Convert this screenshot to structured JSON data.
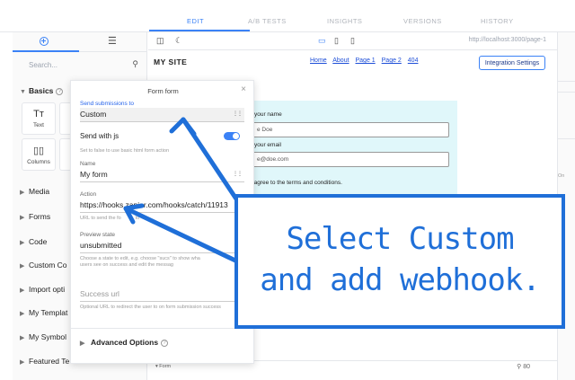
{
  "top_tabs": [
    {
      "label": "EDIT",
      "active": true
    },
    {
      "label": "A/B TESTS",
      "active": false
    },
    {
      "label": "INSIGHTS",
      "active": false
    },
    {
      "label": "VERSIONS",
      "active": false
    },
    {
      "label": "HISTORY",
      "active": false
    }
  ],
  "sidebar": {
    "search_placeholder": "Search...",
    "basics_label": "Basics",
    "blocks": {
      "text": "Text",
      "columns": "Columns"
    },
    "items": [
      "Media",
      "Forms",
      "Code",
      "Custom Co",
      "Import opti",
      "My Templat",
      "My Symbol",
      "Featured Te"
    ]
  },
  "canvas": {
    "url": "http://localhost:3000/page-1",
    "site_title": "MY SITE",
    "nav": [
      "Home",
      "About",
      "Page 1",
      "Page 2",
      "404"
    ],
    "integration_button": "Integration Settings",
    "form_labels": [
      "r your name",
      "r your email",
      "I agree to the terms and conditions."
    ],
    "form_values": [
      "e Doe",
      "e@doe.com"
    ],
    "bottom_label": "Form",
    "zoom": "80",
    "rail_text": "On"
  },
  "panel": {
    "title": "Form form",
    "send_submissions_label": "Send submissions to",
    "send_submissions_value": "Custom",
    "send_with_js_label": "Send with js",
    "send_with_js_on": true,
    "send_with_js_help": "Set to false to use basic html form action",
    "name_label": "Name",
    "name_value": "My form",
    "action_label": "Action",
    "action_value": "https://hooks.zapier.com/hooks/catch/11913",
    "action_help": "URL to send the fo",
    "action_help_tail": "to",
    "preview_label": "Preview state",
    "preview_value": "unsubmitted",
    "preview_help_1": "Choose a state to edit, e.g. choose \"suc",
    "preview_help_1_tail": "s\" to show wha",
    "preview_help_2": "users see on success and edit the messag",
    "success_url_placeholder": "Success url",
    "success_url_help": "Optional URL to redirect the user to on form submission success",
    "advanced_label": "Advanced Options"
  },
  "callout": {
    "line1": "Select Custom",
    "line2": "and add webhook.",
    "color": "#1f6fd8"
  }
}
